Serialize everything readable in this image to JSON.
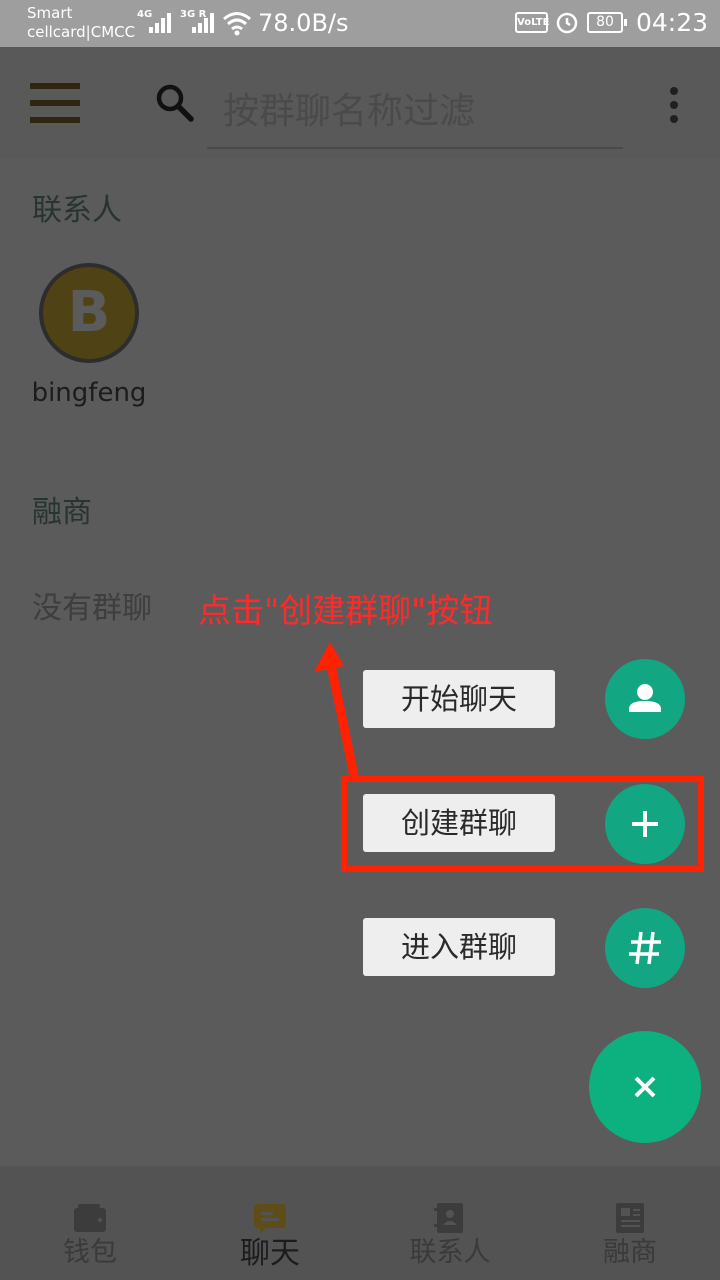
{
  "status_bar": {
    "carrier_line1": "Smart",
    "carrier_line2": "cellcard|CMCC",
    "signal1_label": "4G",
    "signal2_label": "3G R",
    "net_speed": "78.0B/s",
    "volte": "VoLTE",
    "battery": "80",
    "time": "04:23"
  },
  "app_bar": {
    "search_placeholder": "按群聊名称过滤"
  },
  "contacts": {
    "title": "联系人",
    "items": [
      {
        "initial": "B",
        "name": "bingfeng",
        "avatar_color": "#4f4316"
      }
    ]
  },
  "groups": {
    "title": "融商",
    "empty_text": "没有群聊"
  },
  "annotation": {
    "hint": "点击\"创建群聊\"按钮",
    "color": "#ff2a2a"
  },
  "fab_menu": {
    "items": [
      {
        "label": "开始聊天",
        "icon": "person-icon"
      },
      {
        "label": "创建群聊",
        "icon": "plus-icon"
      },
      {
        "label": "进入群聊",
        "icon": "hash-icon"
      }
    ],
    "close_icon": "close-icon",
    "accent": "#13a683"
  },
  "bottom_nav": {
    "items": [
      {
        "label": "钱包",
        "icon": "wallet-icon",
        "active": false
      },
      {
        "label": "聊天",
        "icon": "chat-icon",
        "active": true
      },
      {
        "label": "联系人",
        "icon": "contacts-book-icon",
        "active": false
      },
      {
        "label": "融商",
        "icon": "news-icon",
        "active": false
      }
    ]
  }
}
